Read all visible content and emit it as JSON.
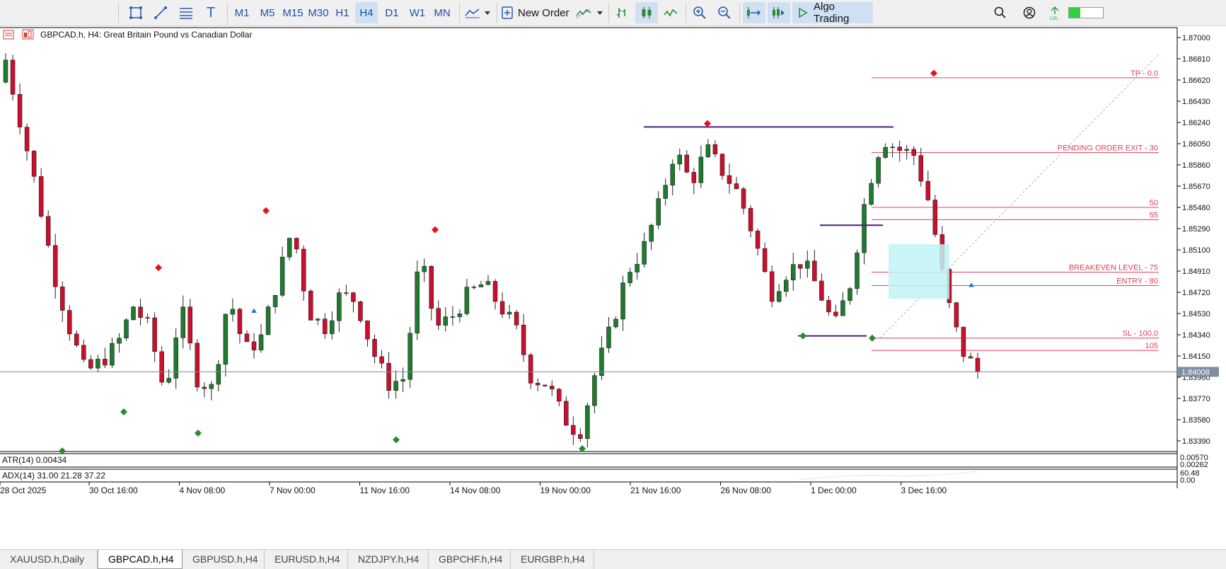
{
  "toolbar": {
    "timeframes": [
      "M1",
      "M5",
      "M15",
      "M30",
      "H1",
      "H4",
      "D1",
      "W1",
      "MN"
    ],
    "active_timeframe": "H4",
    "new_order_label": "New Order",
    "algo_trading_label": "Algo Trading"
  },
  "chart": {
    "title": "GBPCAD.h, H4:  Great Britain Pound vs Canadian Dollar",
    "current_price": "1.84008",
    "price_ticks": [
      "1.87000",
      "1.86810",
      "1.86620",
      "1.86430",
      "1.86240",
      "1.86050",
      "1.85860",
      "1.85670",
      "1.85480",
      "1.85290",
      "1.85100",
      "1.84910",
      "1.84720",
      "1.84530",
      "1.84340",
      "1.84150",
      "1.83960",
      "1.83770",
      "1.83580",
      "1.83390"
    ],
    "time_ticks": [
      "28 Oct 2025",
      "30 Oct 16:00",
      "4 Nov 08:00",
      "7 Nov 00:00",
      "11 Nov 16:00",
      "14 Nov 08:00",
      "19 Nov 00:00",
      "21 Nov 16:00",
      "26 Nov 08:00",
      "1 Dec 00:00",
      "3 Dec 16:00"
    ],
    "fib_levels": [
      {
        "label": "TP - 0.0",
        "price": 1.8664
      },
      {
        "label": "PENDING ORDER EXIT - 30",
        "price": 1.8597
      },
      {
        "label": "50",
        "price": 1.8548
      },
      {
        "label": "55",
        "price": 1.8537
      },
      {
        "label": "BREAKEVEN LEVEL - 75",
        "price": 1.849
      },
      {
        "label": "ENTRY - 80",
        "price": 1.8478
      },
      {
        "label": "SL - 100.0",
        "price": 1.8431
      },
      {
        "label": "105",
        "price": 1.842
      }
    ],
    "atr": {
      "label": "ATR(14) 0.00434",
      "ticks": [
        "0.00570",
        "0.00262"
      ]
    },
    "adx": {
      "label": "ADX(14) 31.00 21.28 37.22",
      "ticks": [
        "60.48",
        "0.00"
      ]
    }
  },
  "chart_data": {
    "type": "candlestick",
    "symbol": "GBPCAD.h",
    "timeframe": "H4",
    "ylim": [
      1.8325,
      1.871
    ],
    "x": [
      "28 Oct 2025",
      "30 Oct 16:00",
      "4 Nov 08:00",
      "7 Nov 00:00",
      "11 Nov 16:00",
      "14 Nov 08:00",
      "19 Nov 00:00",
      "21 Nov 16:00",
      "26 Nov 08:00",
      "1 Dec 00:00",
      "3 Dec 16:00"
    ],
    "close_path": [
      1.868,
      1.862,
      1.856,
      1.849,
      1.844,
      1.84,
      1.841,
      1.8425,
      1.846,
      1.844,
      1.838,
      1.846,
      1.8395,
      1.8385,
      1.847,
      1.842,
      1.843,
      1.848,
      1.853,
      1.8455,
      1.844,
      1.847,
      1.8465,
      1.842,
      1.839,
      1.8395,
      1.8505,
      1.844,
      1.845,
      1.847,
      1.848,
      1.846,
      1.844,
      1.8395,
      1.839,
      1.836,
      1.8345,
      1.84,
      1.844,
      1.849,
      1.851,
      1.855,
      1.86,
      1.857,
      1.86,
      1.858,
      1.856,
      1.852,
      1.847,
      1.849,
      1.85,
      1.8475,
      1.844,
      1.848,
      1.856,
      1.861,
      1.86,
      1.8595,
      1.855,
      1.847,
      1.842,
      1.8401
    ],
    "current_price": 1.84008,
    "fib_levels": [
      1.8664,
      1.8597,
      1.8548,
      1.8537,
      1.849,
      1.8478,
      1.8431,
      1.842
    ]
  }
}
